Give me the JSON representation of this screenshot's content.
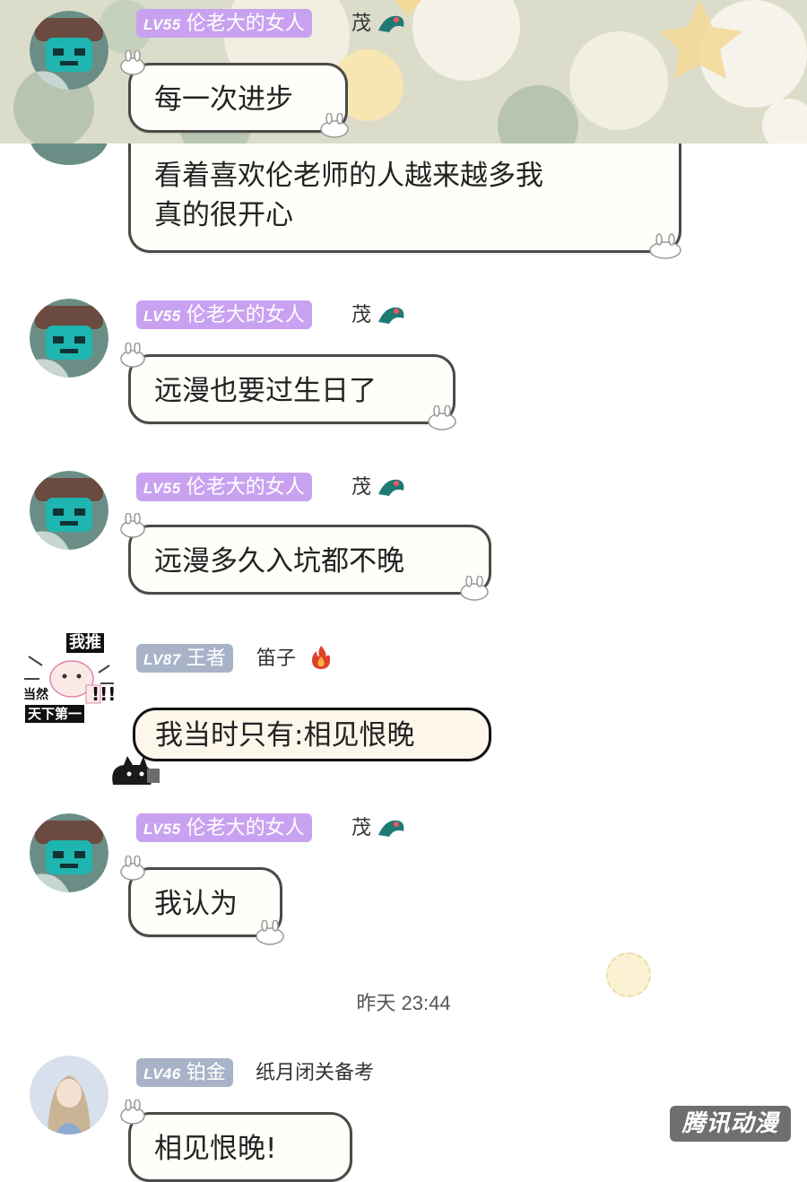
{
  "messages": [
    {
      "badge_level": "LV55",
      "badge_title": "伦老大的女人",
      "nickname": "茂",
      "text": "每一次进步"
    },
    {
      "text_line1": "看着喜欢伦老师的人越来越多我",
      "text_line2": "真的很开心"
    },
    {
      "badge_level": "LV55",
      "badge_title": "伦老大的女人",
      "nickname": "茂",
      "text": "远漫也要过生日了"
    },
    {
      "badge_level": "LV55",
      "badge_title": "伦老大的女人",
      "nickname": "茂",
      "text": "远漫多久入坑都不晚"
    },
    {
      "badge_level": "LV87",
      "badge_title": "王者",
      "nickname": "笛子",
      "text": "我当时只有:相见恨晚",
      "avatar_text_top": "我推",
      "avatar_text_mid": "当然",
      "avatar_text_marks": "!!!",
      "avatar_text_bottom": "天下第一"
    },
    {
      "badge_level": "LV55",
      "badge_title": "伦老大的女人",
      "nickname": "茂",
      "text": "我认为"
    },
    {
      "badge_level": "LV46",
      "badge_title": "铂金",
      "nickname": "纸月闭关备考",
      "text": "相见恨晚!"
    }
  ],
  "timestamp": "昨天 23:44",
  "watermark": "腾讯动漫",
  "icons": {
    "lv55": "dragon-sticker-icon",
    "lv87": "fire-icon",
    "bunny": "bunny-ear-icon",
    "cat": "black-cat-icon"
  },
  "colors": {
    "badge_purple": "#c8a2f0",
    "badge_gray": "#a9b3c8",
    "bubble_border": "#4a4a4a"
  }
}
